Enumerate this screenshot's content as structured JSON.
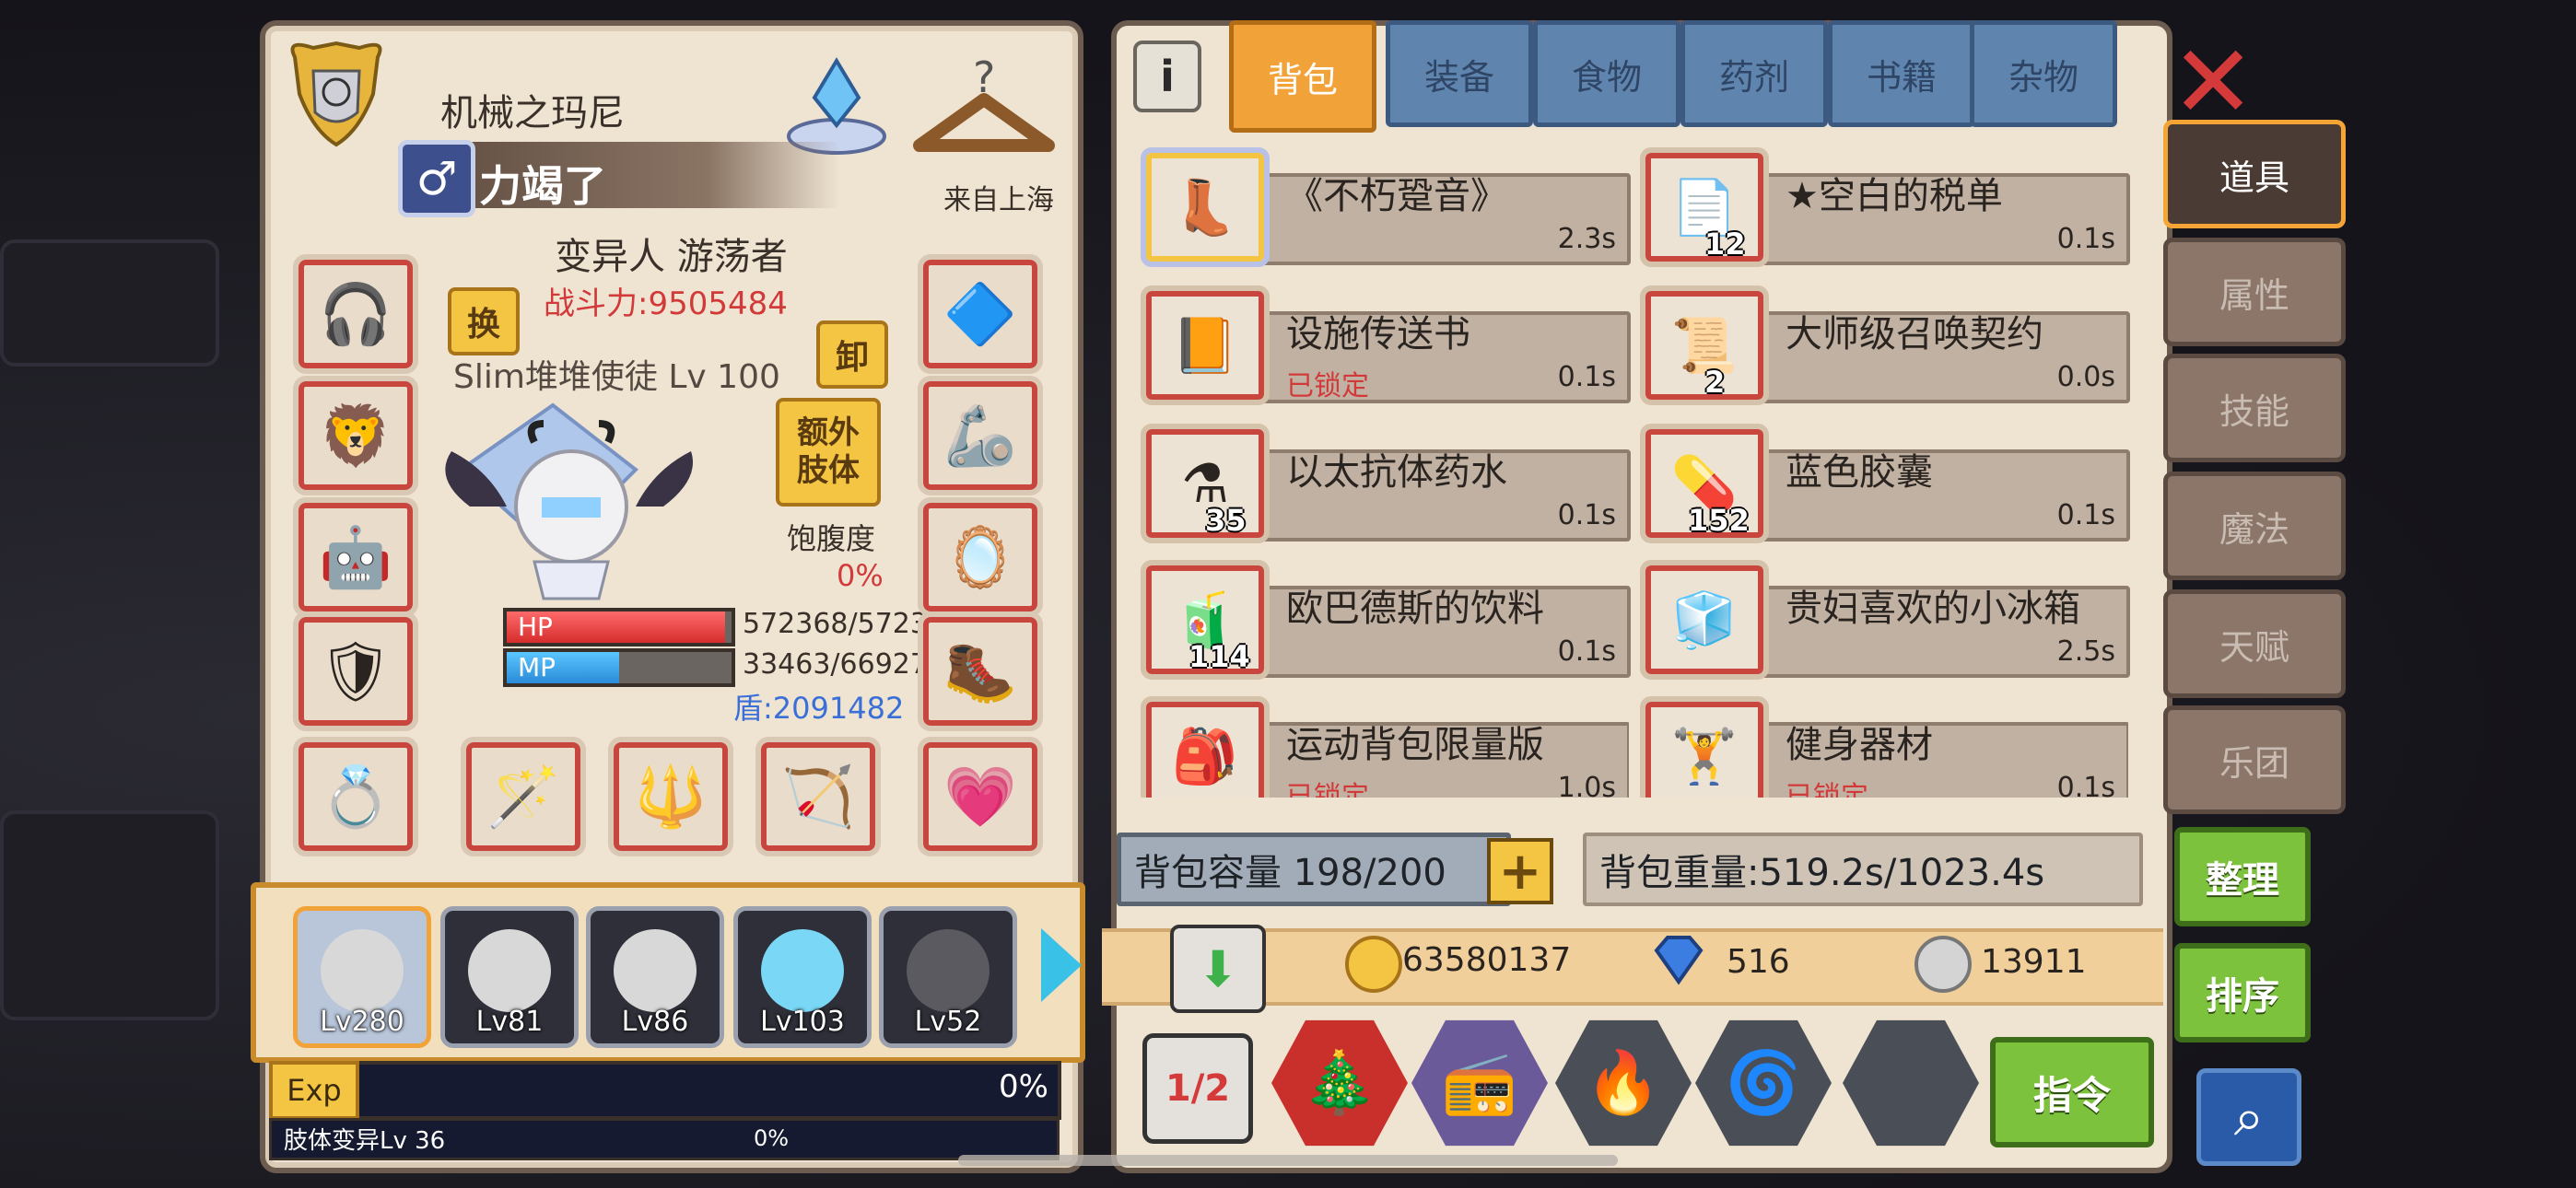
{
  "character": {
    "title_name": "机械之玛尼",
    "player_name": "力竭了",
    "gender_symbol": "♂",
    "origin": "来自上海",
    "class": "变异人 游荡者",
    "battle_power": "战斗力:9505484",
    "bed_label": "Slim堆堆使徒 Lv 100",
    "swap_label": "换",
    "unequip_label": "卸",
    "extra_limb_label": "额外\n肢体",
    "satiety_label": "饱腹度",
    "satiety_value": "0%",
    "hp_label": "HP",
    "hp_value": "572368/5723",
    "hp_fraction": 0.97,
    "mp_label": "MP",
    "mp_value": "33463/66927",
    "mp_fraction": 0.5,
    "shield": "盾:2091482"
  },
  "party": [
    {
      "level": "Lv280"
    },
    {
      "level": "Lv81"
    },
    {
      "level": "Lv86"
    },
    {
      "level": "Lv103"
    },
    {
      "level": "Lv52"
    }
  ],
  "exp": {
    "tag": "Exp",
    "percent": "0%",
    "mutation_label": "肢体变异Lv 36",
    "mutation_percent": "0%"
  },
  "inventory": {
    "info_icon": "i",
    "tabs": [
      "背包",
      "装备",
      "食物",
      "药剂",
      "书籍",
      "杂物"
    ],
    "items": [
      {
        "name": "《不朽跫音》",
        "time": "2.3s",
        "count": "",
        "lock": ""
      },
      {
        "name": "★空白的税单",
        "time": "0.1s",
        "count": "12",
        "lock": ""
      },
      {
        "name": "设施传送书",
        "time": "0.1s",
        "count": "",
        "lock": "已锁定"
      },
      {
        "name": "大师级召唤契约",
        "time": "0.0s",
        "count": "2",
        "lock": ""
      },
      {
        "name": "以太抗体药水",
        "time": "0.1s",
        "count": "35",
        "lock": ""
      },
      {
        "name": "蓝色胶囊",
        "time": "0.1s",
        "count": "152",
        "lock": ""
      },
      {
        "name": "欧巴德斯的饮料",
        "time": "0.1s",
        "count": "114",
        "lock": ""
      },
      {
        "name": "贵妇喜欢的小冰箱",
        "time": "2.5s",
        "count": "",
        "lock": ""
      },
      {
        "name": "运动背包限量版",
        "time": "1.0s",
        "count": "",
        "lock": "已锁定"
      },
      {
        "name": "健身器材",
        "time": "0.1s",
        "count": "",
        "lock": "已锁定"
      }
    ],
    "capacity": "背包容量 198/200",
    "plus": "+",
    "weight": "背包重量:519.2s/1023.4s",
    "gold": "63580137",
    "diamond": "516",
    "silver": "13911",
    "command": "指令",
    "split_label": "1/2"
  },
  "side": {
    "close": "✕",
    "tabs": [
      "道具",
      "属性",
      "技能",
      "魔法",
      "天赋",
      "乐团"
    ],
    "organize": "整理",
    "sort": "排序"
  },
  "colors": {
    "accent_orange": "#f1a33a",
    "tab_blue": "#5f84ad",
    "lock_red": "#d23a3a",
    "btn_green": "#7dc23c"
  }
}
